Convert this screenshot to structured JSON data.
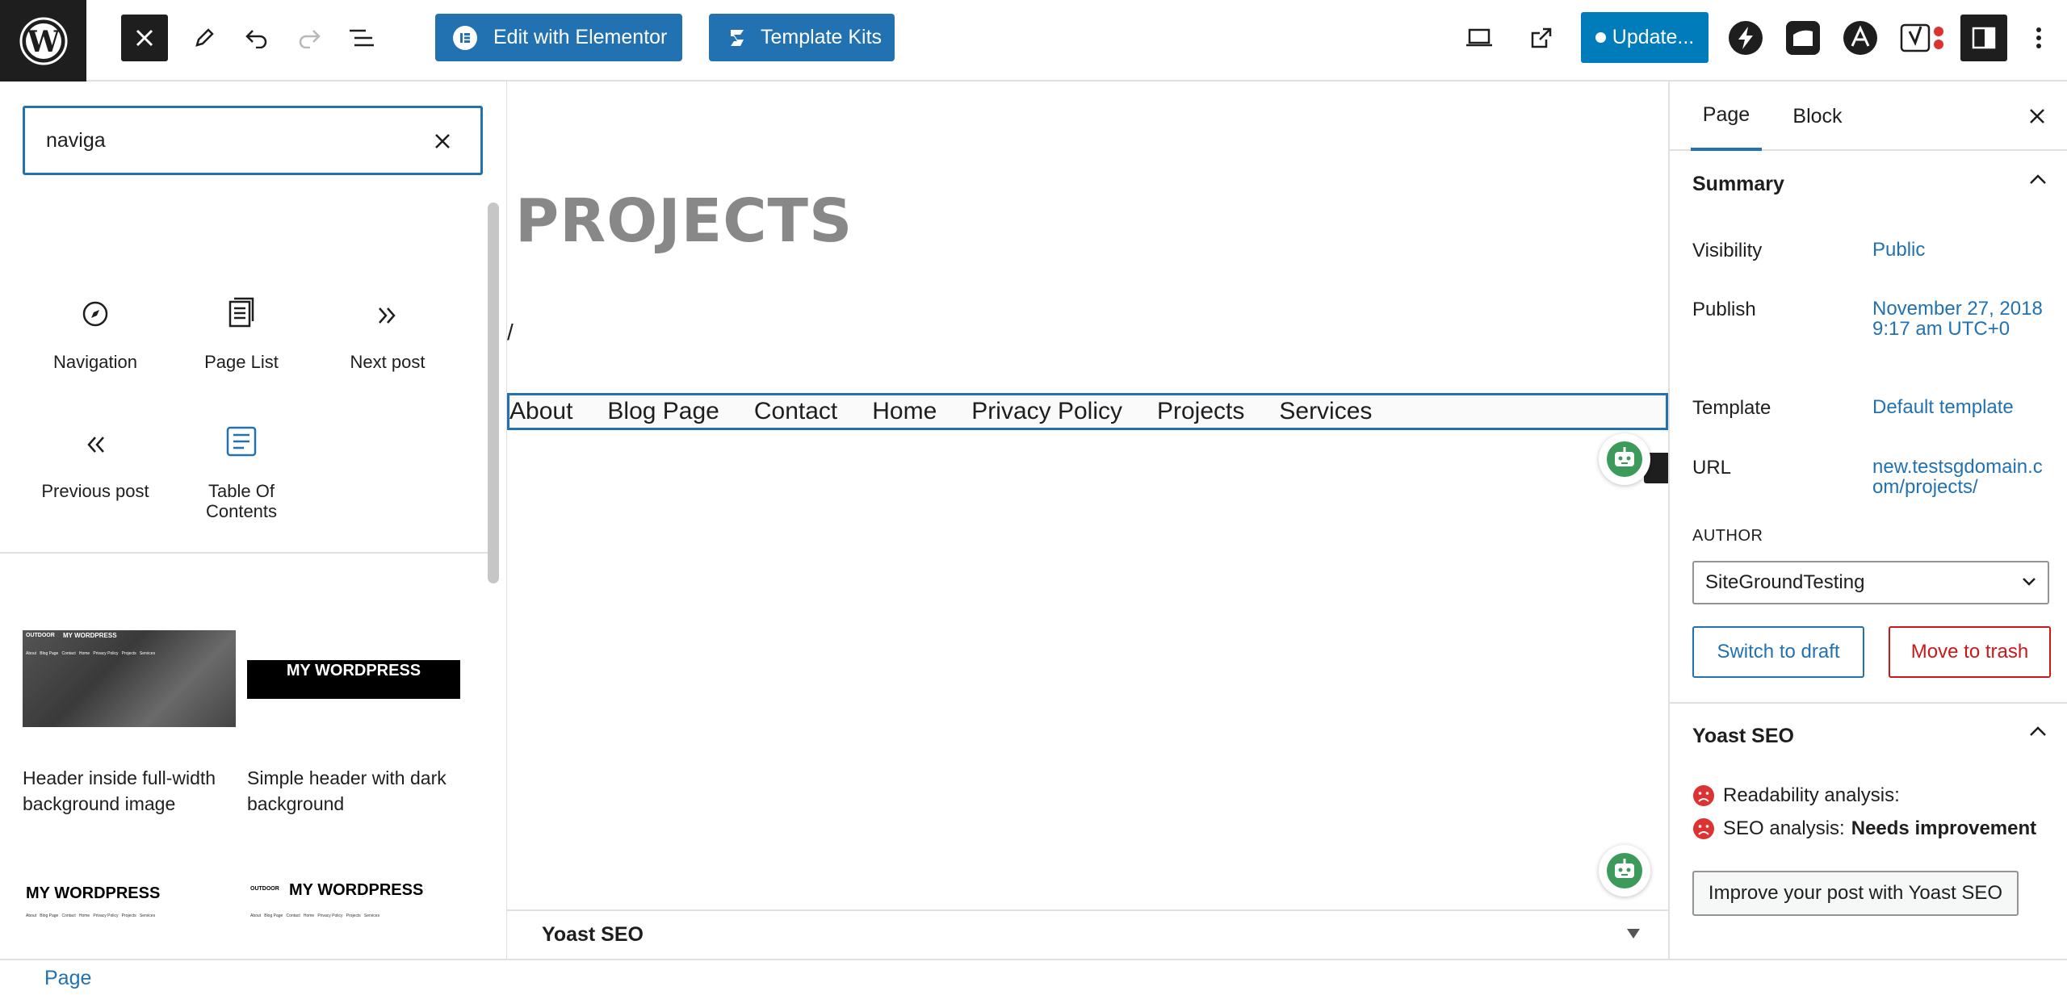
{
  "toolbar": {
    "elementor_label": "Edit with Elementor",
    "kits_label": "Template Kits",
    "update_label": "Update..."
  },
  "inserter": {
    "search_value": "naviga",
    "blocks": [
      {
        "label": "Navigation",
        "icon": "compass-icon"
      },
      {
        "label": "Page List",
        "icon": "page-list-icon"
      },
      {
        "label": "Next post",
        "icon": "double-chevron-right-icon"
      },
      {
        "label": "Previous post",
        "icon": "double-chevron-left-icon"
      },
      {
        "label": "Table Of Contents",
        "icon": "table-of-contents-icon"
      }
    ],
    "patterns": [
      {
        "label": "Header inside full-width background image",
        "brand": "OUTDOOR",
        "title": "MY WORDPRESS",
        "nav": "About   Blog Page   Contact   Home   Privacy Policy   Projects   Services"
      },
      {
        "label": "Simple header with dark background",
        "title": "MY WORDPRESS"
      },
      {
        "title": "MY WORDPRESS",
        "nav": "About   Blog Page   Contact   Home   Privacy Policy   Projects   Services"
      },
      {
        "brand": "OUTDOOR",
        "title": "MY WORDPRESS",
        "nav": "About   Blog Page   Contact   Home   Privacy Policy   Projects   Services"
      }
    ]
  },
  "canvas": {
    "heading": "PROJECTS",
    "separator": "/",
    "nav_links": [
      "About",
      "Blog Page",
      "Contact",
      "Home",
      "Privacy Policy",
      "Projects",
      "Services"
    ],
    "meta_box_title": "Yoast SEO"
  },
  "sidebar": {
    "tabs": [
      "Page",
      "Block"
    ],
    "summary_title": "Summary",
    "visibility_label": "Visibility",
    "visibility_value": "Public",
    "publish_label": "Publish",
    "publish_value": "November 27, 2018 9:17 am UTC+0",
    "template_label": "Template",
    "template_value": "Default template",
    "url_label": "URL",
    "url_value": "new.testsgdomain.com/projects/",
    "author_label": "AUTHOR",
    "author_value": "SiteGroundTesting",
    "switch_draft_label": "Switch to draft",
    "trash_label": "Move to trash",
    "yoast_title": "Yoast SEO",
    "readability_label": "Readability analysis:",
    "seo_label": "SEO analysis:",
    "seo_value": "Needs improvement",
    "improve_label": "Improve your post with Yoast SEO"
  },
  "footer": {
    "breadcrumb": "Page"
  },
  "colors": {
    "accent": "#2271b1",
    "update": "#007cba",
    "danger": "#cc1818",
    "dark": "#1e1e1e"
  }
}
